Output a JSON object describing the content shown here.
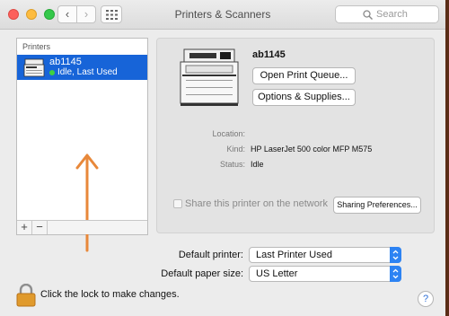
{
  "window": {
    "title": "Printers & Scanners"
  },
  "toolbar": {
    "search_placeholder": "Search"
  },
  "printer_list": {
    "header": "Printers",
    "items": [
      {
        "name": "ab1145",
        "status": "Idle, Last Used",
        "selected": true
      }
    ],
    "add_label": "+",
    "remove_label": "−"
  },
  "details": {
    "name": "ab1145",
    "open_queue_label": "Open Print Queue...",
    "options_label": "Options & Supplies...",
    "location_label": "Location:",
    "location_value": "",
    "kind_label": "Kind:",
    "kind_value": "HP LaserJet 500 color MFP M575",
    "status_label": "Status:",
    "status_value": "Idle",
    "share_label": "Share this printer on the network",
    "sharing_prefs_label": "Sharing Preferences..."
  },
  "defaults": {
    "printer_label": "Default printer:",
    "printer_value": "Last Printer Used",
    "paper_label": "Default paper size:",
    "paper_value": "US Letter"
  },
  "footer": {
    "lock_text": "Click the lock to make changes.",
    "help_label": "?"
  },
  "colors": {
    "selection": "#1764d8",
    "annotation_arrow": "#e8883a",
    "status_dot": "#3fd13f"
  }
}
